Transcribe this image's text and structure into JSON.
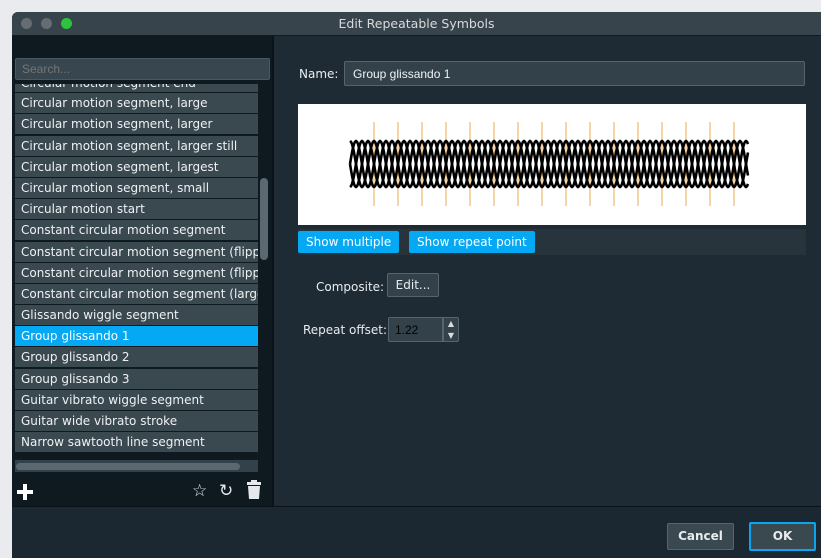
{
  "window": {
    "title": "Edit Repeatable Symbols"
  },
  "search": {
    "placeholder": "Search..."
  },
  "list": {
    "partial_item": "Circular motion segment end",
    "items": [
      "Circular motion segment, large",
      "Circular motion segment, larger",
      "Circular motion segment, larger still",
      "Circular motion segment, largest",
      "Circular motion segment, small",
      "Circular motion start",
      "Constant circular motion segment",
      "Constant circular motion segment (flipped)",
      "Constant circular motion segment (flipped)",
      "Constant circular motion segment (large)",
      "Glissando wiggle segment",
      "Group glissando 1",
      "Group glissando 2",
      "Group glissando 3",
      "Guitar vibrato wiggle segment",
      "Guitar wide vibrato stroke",
      "Narrow sawtooth line segment"
    ],
    "selected_index": 11
  },
  "left_toolbar": {
    "add_icon": "plus-icon",
    "favorite_icon": "star-icon",
    "revert_icon": "revert-icon",
    "delete_icon": "trash-icon",
    "favorite_glyph": "☆",
    "revert_glyph": "↻",
    "delete_glyph": "🗑"
  },
  "editor": {
    "name_label": "Name:",
    "name_value": "Group glissando 1",
    "show_multiple_label": "Show multiple",
    "show_repeat_point_label": "Show repeat point",
    "composite_label": "Composite:",
    "edit_label": "Edit...",
    "repeat_offset_label": "Repeat offset:",
    "repeat_offset_value": "1.22",
    "step_up_glyph": "▲",
    "step_down_glyph": "▼"
  },
  "footer": {
    "cancel_label": "Cancel",
    "ok_label": "OK"
  },
  "colors": {
    "accent": "#05a8f2",
    "window_bg": "#1f2b34",
    "list_item_bg": "#3a4850",
    "preview_marker": "#f2a74b",
    "glyph": "#000000"
  }
}
